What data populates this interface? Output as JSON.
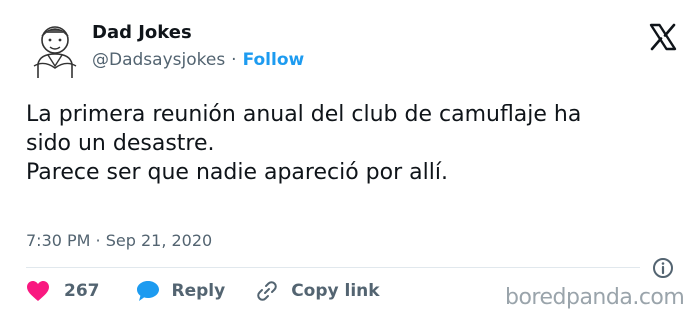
{
  "author": {
    "name": "Dad Jokes",
    "handle": "@Dadsaysjokes",
    "separator": "·",
    "follow_label": "Follow"
  },
  "tweet": {
    "lines": [
      "La primera reunión anual del club de camuflaje ha",
      "sido un desastre.",
      "Parece ser que nadie apareció por allí."
    ],
    "timestamp": "7:30 PM · Sep 21, 2020"
  },
  "actions": {
    "like_count": "267",
    "reply_label": "Reply",
    "copy_link_label": "Copy link"
  },
  "watermark": "boredpanda.com",
  "colors": {
    "accent": "#1d9bf0",
    "like": "#f91880",
    "secondary_text": "#536471",
    "text": "#0f1419"
  },
  "icons": [
    "avatar-illustration",
    "x-logo-icon",
    "info-icon",
    "heart-icon",
    "reply-bubble-icon",
    "link-icon"
  ]
}
